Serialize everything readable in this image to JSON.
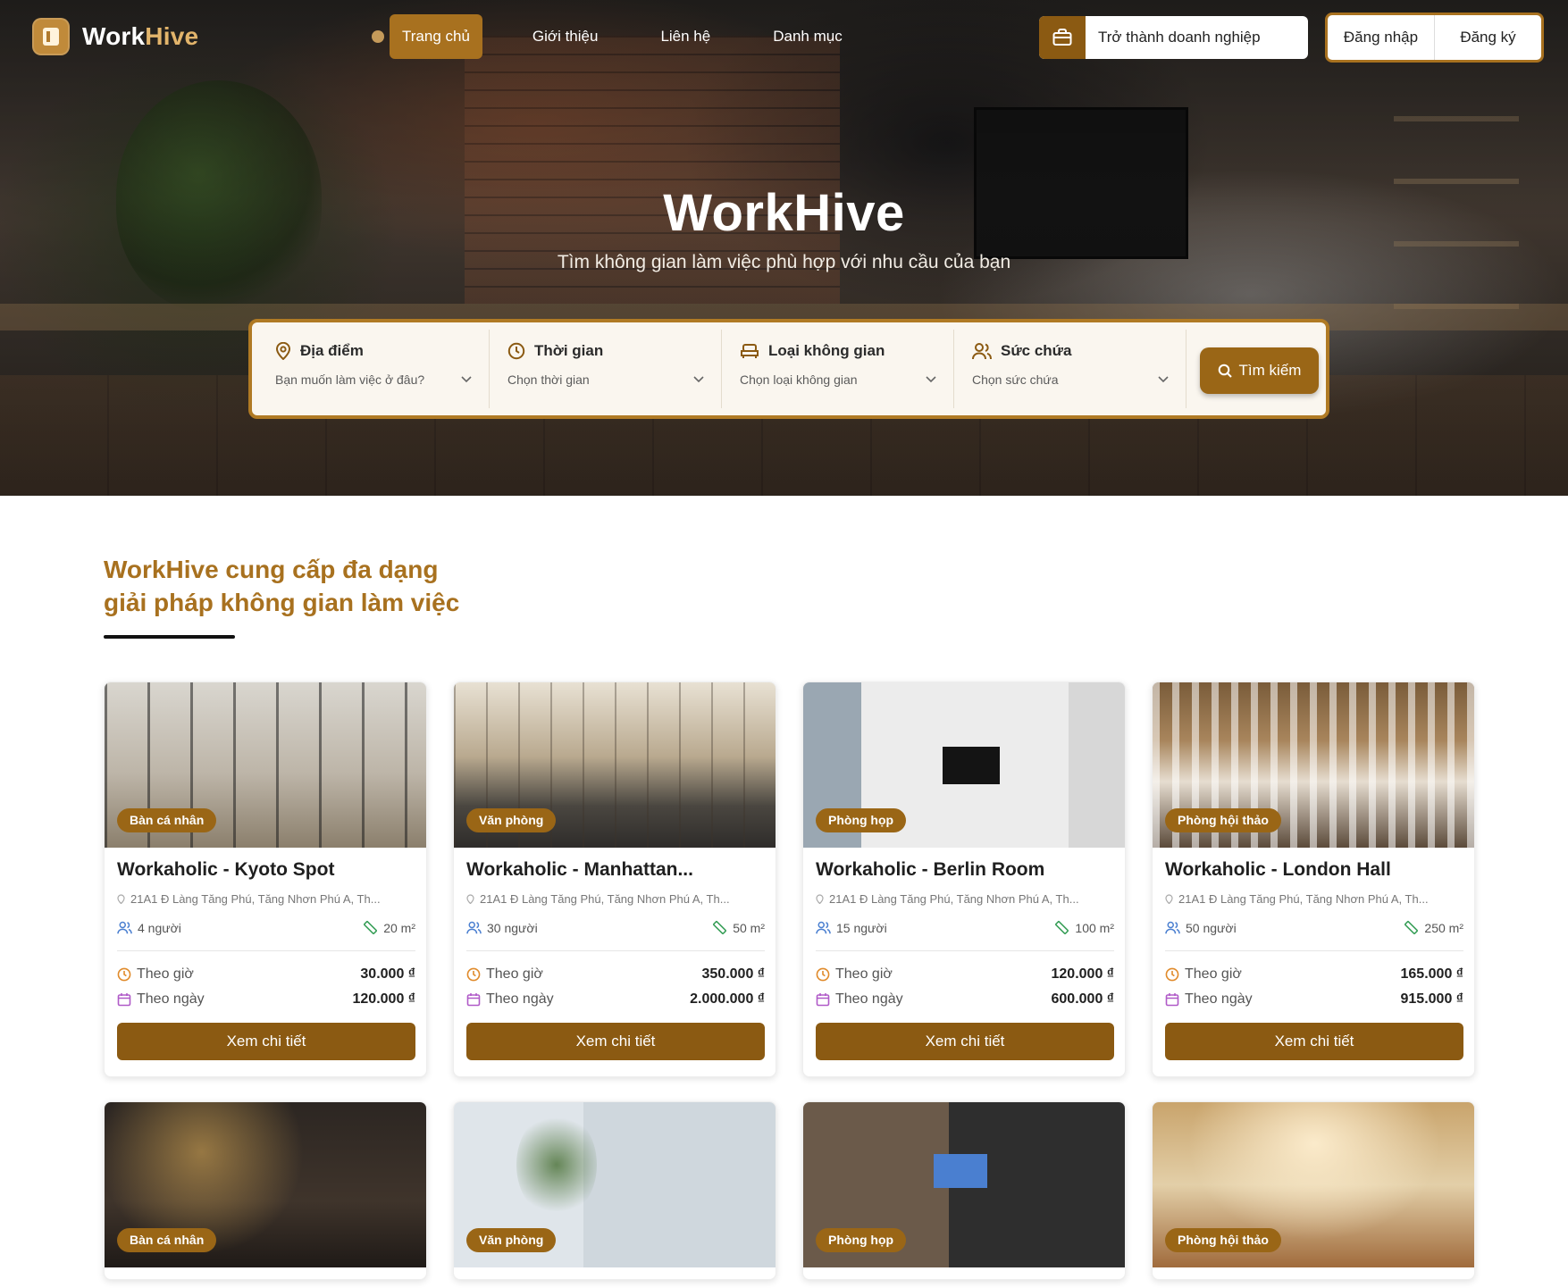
{
  "nav": {
    "logo": {
      "part1": "Work",
      "part2": "Hive"
    },
    "menu": [
      {
        "label": "Trang chủ",
        "active": true
      },
      {
        "label": "Giới thiệu",
        "active": false
      },
      {
        "label": "Liên hệ",
        "active": false
      },
      {
        "label": "Danh mục",
        "active": false
      }
    ],
    "business_button": "Trở thành doanh nghiệp",
    "login": "Đăng nhập",
    "register": "Đăng ký"
  },
  "hero": {
    "title": "WorkHive",
    "subtitle": "Tìm không gian làm việc phù hợp với nhu cầu của bạn"
  },
  "search": {
    "fields": [
      {
        "label": "Địa điểm",
        "placeholder": "Bạn muốn làm việc ở đâu?",
        "icon": "map-pin-icon"
      },
      {
        "label": "Thời gian",
        "placeholder": "Chọn thời gian",
        "icon": "clock-icon"
      },
      {
        "label": "Loại không gian",
        "placeholder": "Chọn loại không gian",
        "icon": "sofa-icon"
      },
      {
        "label": "Sức chứa",
        "placeholder": "Chọn sức chứa",
        "icon": "users-icon"
      }
    ],
    "button": "Tìm kiếm"
  },
  "section": {
    "title_line1": "WorkHive cung cấp đa dạng",
    "title_line2": "giải pháp không gian làm việc"
  },
  "price_labels": {
    "hourly": "Theo giờ",
    "daily": "Theo ngày"
  },
  "detail_label": "Xem chi tiết",
  "cards": [
    {
      "badge": "Bàn cá nhân",
      "name": "Workaholic - Kyoto Spot",
      "address": "21A1 Đ Làng Tăng Phú, Tăng Nhơn Phú A, Th...",
      "capacity": "4 người",
      "area": "20 m²",
      "hourly": "30.000 ₫",
      "daily": "120.000 ₫"
    },
    {
      "badge": "Văn phòng",
      "name": "Workaholic - Manhattan...",
      "address": "21A1 Đ Làng Tăng Phú, Tăng Nhơn Phú A, Th...",
      "capacity": "30 người",
      "area": "50 m²",
      "hourly": "350.000 ₫",
      "daily": "2.000.000 ₫"
    },
    {
      "badge": "Phòng họp",
      "name": "Workaholic - Berlin Room",
      "address": "21A1 Đ Làng Tăng Phú, Tăng Nhơn Phú A, Th...",
      "capacity": "15 người",
      "area": "100 m²",
      "hourly": "120.000 ₫",
      "daily": "600.000 ₫"
    },
    {
      "badge": "Phòng hội thảo",
      "name": "Workaholic - London Hall",
      "address": "21A1 Đ Làng Tăng Phú, Tăng Nhơn Phú A, Th...",
      "capacity": "50 người",
      "area": "250 m²",
      "hourly": "165.000 ₫",
      "daily": "915.000 ₫"
    }
  ],
  "cards_row2": [
    {
      "badge": "Bàn cá nhân"
    },
    {
      "badge": "Văn phòng"
    },
    {
      "badge": "Phòng họp"
    },
    {
      "badge": "Phòng hội thảo"
    }
  ],
  "colors": {
    "accent": "#a8711f",
    "button": "#8b5a12",
    "badge": "#9a6616"
  }
}
